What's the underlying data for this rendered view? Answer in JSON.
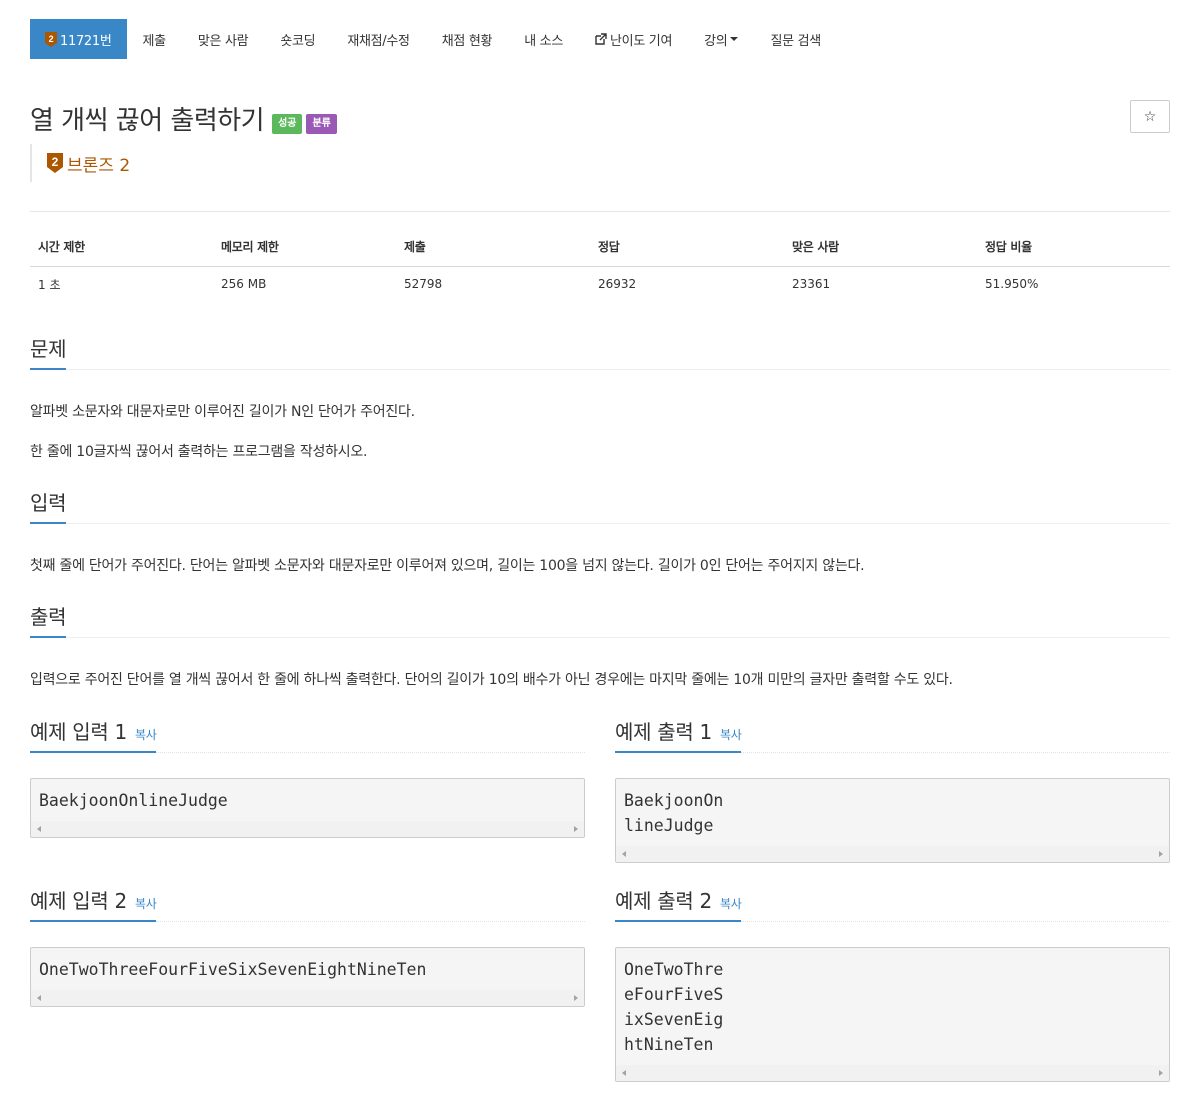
{
  "nav": {
    "problem_number": "11721번",
    "tier_number": "2",
    "items": [
      {
        "label": "제출"
      },
      {
        "label": "맞은 사람"
      },
      {
        "label": "숏코딩"
      },
      {
        "label": "재채점/수정"
      },
      {
        "label": "채점 현황"
      },
      {
        "label": "내 소스"
      },
      {
        "label": "난이도 기여",
        "icon": "external-link-icon"
      },
      {
        "label": "강의",
        "dropdown": true
      },
      {
        "label": "질문 검색"
      }
    ]
  },
  "problem": {
    "title": "열 개씩 끊어 출력하기",
    "badges": [
      "성공",
      "분류"
    ],
    "tier_label": "브론즈 2",
    "tier_number": "2",
    "star_icon": "☆"
  },
  "info": {
    "headers": [
      "시간 제한",
      "메모리 제한",
      "제출",
      "정답",
      "맞은 사람",
      "정답 비율"
    ],
    "values": [
      "1 초",
      "256 MB",
      "52798",
      "26932",
      "23361",
      "51.950%"
    ]
  },
  "sections": {
    "description": {
      "heading": "문제",
      "paragraphs": [
        "알파벳 소문자와 대문자로만 이루어진 길이가 N인 단어가 주어진다.",
        "한 줄에 10글자씩 끊어서 출력하는 프로그램을 작성하시오."
      ]
    },
    "input": {
      "heading": "입력",
      "text": "첫째 줄에 단어가 주어진다. 단어는 알파벳 소문자와 대문자로만 이루어져 있으며, 길이는 100을 넘지 않는다. 길이가 0인 단어는 주어지지 않는다."
    },
    "output": {
      "heading": "출력",
      "text": "입력으로 주어진 단어를 열 개씩 끊어서 한 줄에 하나씩 출력한다. 단어의 길이가 10의 배수가 아닌 경우에는 마지막 줄에는 10개 미만의 글자만 출력할 수도 있다."
    }
  },
  "samples": {
    "copy_label": "복사",
    "input1": {
      "heading": "예제 입력 1",
      "content": "BaekjoonOnlineJudge"
    },
    "output1": {
      "heading": "예제 출력 1",
      "content": "BaekjoonOn\nlineJudge"
    },
    "input2": {
      "heading": "예제 입력 2",
      "content": "OneTwoThreeFourFiveSixSevenEightNineTen"
    },
    "output2": {
      "heading": "예제 출력 2",
      "content": "OneTwoThre\neFourFiveS\nixSevenEig\nhtNineTen"
    }
  },
  "colors": {
    "accent": "#3a87c8",
    "success": "#5cb85c",
    "class_badge": "#9b59b6",
    "bronze": "#ad5600"
  }
}
